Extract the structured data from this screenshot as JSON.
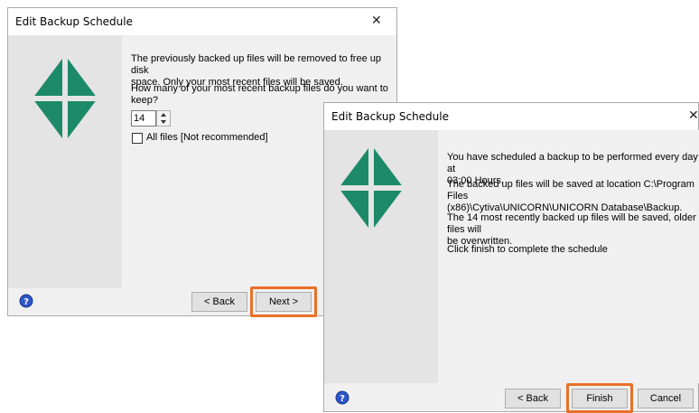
{
  "colors": {
    "logo": "#1d8a67",
    "highlight": "#e8712a",
    "help_icon": "#2d56c7"
  },
  "dialog1": {
    "title": "Edit Backup Schedule",
    "close_glyph": "✕",
    "line1": "The previously backed up files will be removed to free up disk",
    "line2": "space. Only your most recent files will be saved.",
    "question": "How many of your most recent backup files do you want to keep?",
    "keep_count": "14",
    "all_files_label": "All files [Not recommended]",
    "back_label": "< Back",
    "next_label": "Next >"
  },
  "dialog2": {
    "title": "Edit Backup Schedule",
    "close_glyph": "✕",
    "p1_line1": "You have scheduled a backup to be performed every day at",
    "p1_line2": "03:00 Hours.",
    "p2_line1": "The backed up files will be saved at location C:\\Program Files",
    "p2_line2": "(x86)\\Cytiva\\UNICORN\\UNICORN Database\\Backup.",
    "p3_line1": "The 14 most recently backed up files will be saved, older files will",
    "p3_line2": "be overwritten.",
    "p4": "Click finish to complete the schedule",
    "back_label": "< Back",
    "finish_label": "Finish",
    "cancel_label": "Cancel"
  }
}
